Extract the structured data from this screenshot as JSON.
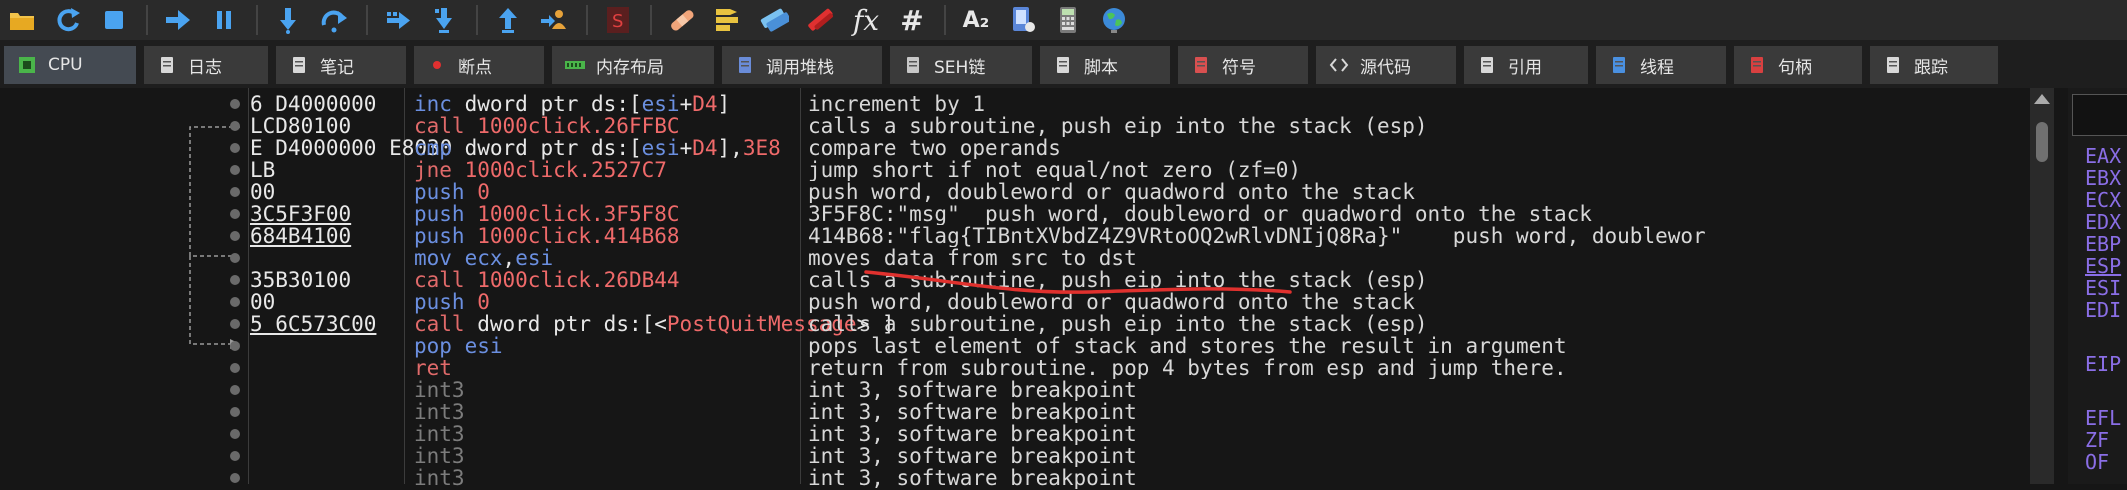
{
  "toolbar": {
    "buttons": [
      {
        "icon": "open-folder-icon"
      },
      {
        "icon": "restart-icon"
      },
      {
        "icon": "stop-icon"
      },
      {
        "icon": "run-icon"
      },
      {
        "icon": "pause-icon"
      },
      {
        "icon": "step-into-icon"
      },
      {
        "icon": "step-over-icon"
      },
      {
        "icon": "trace-into-icon"
      },
      {
        "icon": "trace-over-icon"
      },
      {
        "icon": "execute-till-return-icon"
      },
      {
        "icon": "run-to-user-code-icon"
      },
      {
        "icon": "scylla-icon"
      },
      {
        "icon": "patch-icon"
      },
      {
        "icon": "comments-icon"
      },
      {
        "icon": "labels-icon"
      },
      {
        "icon": "bookmarks-icon"
      },
      {
        "icon": "function-icon",
        "glyph": "fx"
      },
      {
        "icon": "hash-icon",
        "glyph": "#"
      },
      {
        "icon": "font-icon",
        "glyph": "A₂"
      },
      {
        "icon": "device-icon"
      },
      {
        "icon": "calculator-icon"
      },
      {
        "icon": "globe-icon"
      }
    ]
  },
  "tabs": [
    {
      "label": "CPU",
      "icon": "cpu-icon",
      "active": true
    },
    {
      "label": "日志",
      "icon": "log-icon"
    },
    {
      "label": "笔记",
      "icon": "notes-icon"
    },
    {
      "label": "断点",
      "icon": "breakpoint-icon"
    },
    {
      "label": "内存布局",
      "icon": "memory-map-icon"
    },
    {
      "label": "调用堆栈",
      "icon": "call-stack-icon"
    },
    {
      "label": "SEH链",
      "icon": "seh-chain-icon"
    },
    {
      "label": "脚本",
      "icon": "script-icon"
    },
    {
      "label": "符号",
      "icon": "symbols-icon"
    },
    {
      "label": "源代码",
      "icon": "source-icon"
    },
    {
      "label": "引用",
      "icon": "references-icon"
    },
    {
      "label": "线程",
      "icon": "threads-icon"
    },
    {
      "label": "句柄",
      "icon": "handles-icon"
    },
    {
      "label": "跟踪",
      "icon": "trace-icon"
    }
  ],
  "bytes": [
    {
      "text": "6 D4000000",
      "underline": false
    },
    {
      "text": "LCD80100",
      "underline": false
    },
    {
      "text": "E D4000000 E8030",
      "underline": false
    },
    {
      "text": "LB",
      "underline": false
    },
    {
      "text": "00",
      "underline": false
    },
    {
      "text": "3C5F3F00",
      "underline": true
    },
    {
      "text": "684B4100",
      "underline": true
    },
    {
      "text": "",
      "underline": false
    },
    {
      "text": "35B30100",
      "underline": false
    },
    {
      "text": "00",
      "underline": false
    },
    {
      "text": "5 6C573C00",
      "underline": true
    },
    {
      "text": "",
      "underline": false
    },
    {
      "text": "",
      "underline": false
    },
    {
      "text": "",
      "underline": false
    },
    {
      "text": "",
      "underline": false
    },
    {
      "text": "",
      "underline": false
    },
    {
      "text": "",
      "underline": false
    },
    {
      "text": "",
      "underline": false
    }
  ],
  "disasm": [
    {
      "mnemonic": "inc",
      "mclass": "m-blue",
      "parts": [
        {
          "t": "dword ptr ",
          "c": "m-white"
        },
        {
          "t": "ds",
          "c": "m-white"
        },
        {
          "t": ":[",
          "c": "m-white"
        },
        {
          "t": "esi",
          "c": "op-reg"
        },
        {
          "t": "+",
          "c": "m-white"
        },
        {
          "t": "D4",
          "c": "op-call"
        },
        {
          "t": "]",
          "c": "m-white"
        }
      ]
    },
    {
      "mnemonic": "call",
      "mclass": "m-red",
      "parts": [
        {
          "t": "1000click.26FFBC",
          "c": "op-call"
        }
      ]
    },
    {
      "mnemonic": "cmp",
      "mclass": "m-blue",
      "parts": [
        {
          "t": "dword ptr ",
          "c": "m-white"
        },
        {
          "t": "ds",
          "c": "m-white"
        },
        {
          "t": ":[",
          "c": "m-white"
        },
        {
          "t": "esi",
          "c": "op-reg"
        },
        {
          "t": "+",
          "c": "m-white"
        },
        {
          "t": "D4",
          "c": "op-call"
        },
        {
          "t": "],",
          "c": "m-white"
        },
        {
          "t": "3E8",
          "c": "op-call"
        }
      ]
    },
    {
      "mnemonic": "jne",
      "mclass": "m-red",
      "parts": [
        {
          "t": "1000click.2527C7",
          "c": "op-call"
        }
      ]
    },
    {
      "mnemonic": "push",
      "mclass": "m-blue",
      "parts": [
        {
          "t": "0",
          "c": "op-call"
        }
      ]
    },
    {
      "mnemonic": "push",
      "mclass": "m-blue",
      "parts": [
        {
          "t": "1000click.3F5F8C",
          "c": "op-call"
        }
      ]
    },
    {
      "mnemonic": "push",
      "mclass": "m-blue",
      "parts": [
        {
          "t": "1000click.414B68",
          "c": "op-call"
        }
      ]
    },
    {
      "mnemonic": "mov",
      "mclass": "m-blue",
      "parts": [
        {
          "t": "ecx",
          "c": "op-reg"
        },
        {
          "t": ",",
          "c": "m-white"
        },
        {
          "t": "esi",
          "c": "op-reg"
        }
      ]
    },
    {
      "mnemonic": "call",
      "mclass": "m-red",
      "parts": [
        {
          "t": "1000click.26DB44",
          "c": "op-call"
        }
      ]
    },
    {
      "mnemonic": "push",
      "mclass": "m-blue",
      "parts": [
        {
          "t": "0",
          "c": "op-call"
        }
      ]
    },
    {
      "mnemonic": "call",
      "mclass": "m-red",
      "parts": [
        {
          "t": "dword ptr ",
          "c": "m-white"
        },
        {
          "t": "ds",
          "c": "m-white"
        },
        {
          "t": ":[<",
          "c": "m-white"
        },
        {
          "t": "PostQuitMessage",
          "c": "op-call"
        },
        {
          "t": "> ]",
          "c": "m-white"
        }
      ]
    },
    {
      "mnemonic": "pop",
      "mclass": "m-blue",
      "parts": [
        {
          "t": "esi",
          "c": "op-reg"
        }
      ]
    },
    {
      "mnemonic": "ret",
      "mclass": "m-red",
      "parts": []
    },
    {
      "mnemonic": "int3",
      "mclass": "m-gray",
      "parts": []
    },
    {
      "mnemonic": "int3",
      "mclass": "m-gray",
      "parts": []
    },
    {
      "mnemonic": "int3",
      "mclass": "m-gray",
      "parts": []
    },
    {
      "mnemonic": "int3",
      "mclass": "m-gray",
      "parts": []
    },
    {
      "mnemonic": "int3",
      "mclass": "m-gray",
      "parts": []
    }
  ],
  "comments": [
    "increment by 1",
    "calls a subroutine, push eip into the stack (esp)",
    "compare two operands",
    "jump short if not equal/not zero (zf=0)",
    "push word, doubleword or quadword onto the stack",
    "3F5F8C:\"msg\"  push word, doubleword or quadword onto the stack",
    "414B68:\"flag{TIBntXVbdZ4Z9VRtoOQ2wRlvDNIjQ8Ra}\"    push word, doublewor",
    "moves data from src to dst",
    "calls a subroutine, push eip into the stack (esp)",
    "push word, doubleword or quadword onto the stack",
    "calls a subroutine, push eip into the stack (esp)",
    "pops last element of stack and stores the result in argument",
    "return from subroutine. pop 4 bytes from esp and jump there.",
    "int 3, software breakpoint",
    "int 3, software breakpoint",
    "int 3, software breakpoint",
    "int 3, software breakpoint",
    "int 3, software breakpoint"
  ],
  "registers": [
    {
      "name": "EAX",
      "underline": false
    },
    {
      "name": "EBX",
      "underline": false
    },
    {
      "name": "ECX",
      "underline": false
    },
    {
      "name": "EDX",
      "underline": false
    },
    {
      "name": "EBP",
      "underline": false
    },
    {
      "name": "ESP",
      "underline": true
    },
    {
      "name": "ESI",
      "underline": false
    },
    {
      "name": "EDI",
      "underline": false
    },
    {
      "name": "EIP",
      "underline": false
    },
    {
      "name": "EFL",
      "underline": false
    },
    {
      "name": "ZF",
      "underline": false
    },
    {
      "name": "OF",
      "underline": false
    }
  ],
  "colors": {
    "accent_red": "#e0312e",
    "register_purple": "#8a6ee6",
    "mnemonic_blue": "#6b8fe0",
    "call_red": "#ef6a6a"
  }
}
